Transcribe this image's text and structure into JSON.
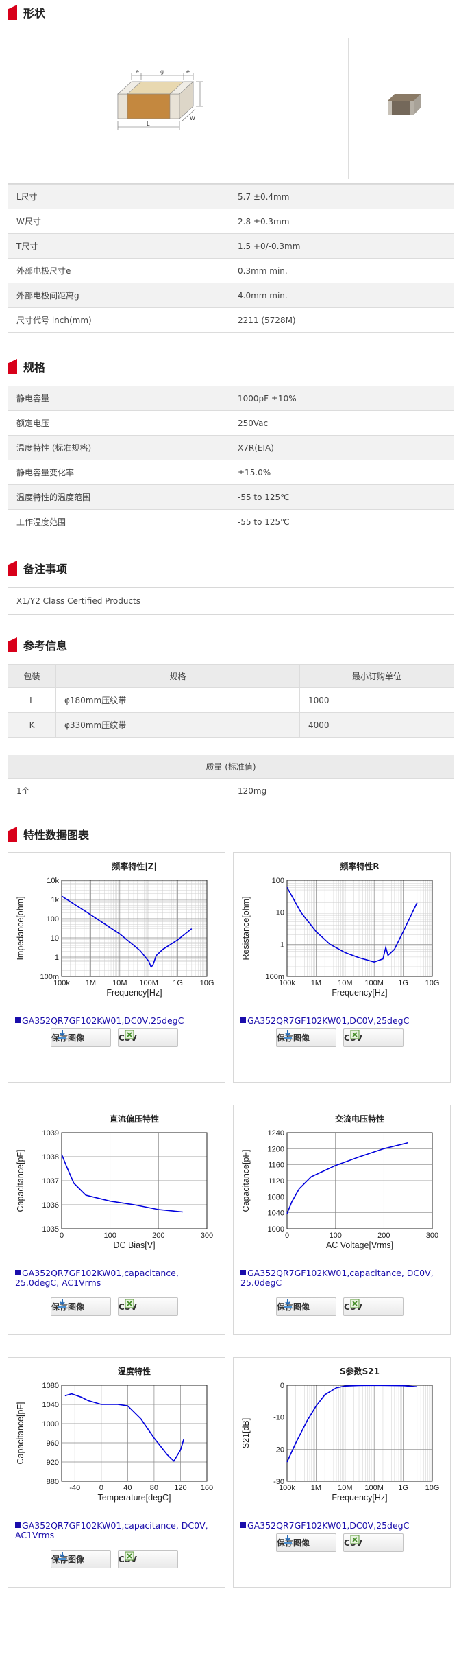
{
  "sections": {
    "shape": "形状",
    "spec": "规格",
    "notes": "备注事项",
    "reference": "参考信息",
    "charts": "特性数据图表"
  },
  "diagram": {
    "e": "e",
    "g": "g",
    "T": "T",
    "L": "L",
    "W": "W"
  },
  "shape_rows": [
    {
      "k": "L尺寸",
      "v": "5.7 ±0.4mm"
    },
    {
      "k": "W尺寸",
      "v": "2.8 ±0.3mm"
    },
    {
      "k": "T尺寸",
      "v": "1.5 +0/-0.3mm"
    },
    {
      "k": "外部电极尺寸e",
      "v": "0.3mm min."
    },
    {
      "k": "外部电极间距离g",
      "v": "4.0mm min."
    },
    {
      "k": "尺寸代号 inch(mm)",
      "v": "2211 (5728M)"
    }
  ],
  "spec_rows": [
    {
      "k": "静电容量",
      "v": "1000pF ±10%"
    },
    {
      "k": "额定电压",
      "v": "250Vac"
    },
    {
      "k": "温度特性 (标准规格)",
      "v": "X7R(EIA)"
    },
    {
      "k": "静电容量变化率",
      "v": "±15.0%"
    },
    {
      "k": "温度特性的温度范围",
      "v": "-55 to 125℃"
    },
    {
      "k": "工作温度范围",
      "v": "-55 to 125℃"
    }
  ],
  "notes_text": "X1/Y2 Class Certified Products",
  "packaging": {
    "headers": [
      "包装",
      "规格",
      "最小订购单位"
    ],
    "rows": [
      {
        "code": "L",
        "spec": "φ180mm压纹带",
        "min": "1000"
      },
      {
        "code": "K",
        "spec": "φ330mm压纹带",
        "min": "4000"
      }
    ]
  },
  "mass": {
    "header": "质量 (标准值)",
    "qty": "1个",
    "value": "120mg"
  },
  "buttons": {
    "save": "保存图像",
    "csv": "CSV"
  },
  "colors": {
    "accent": "#d8001a",
    "curve": "#0000dd",
    "link": "#1a0dab"
  },
  "chart_data": [
    {
      "type": "line",
      "title": "频率特性|Z|",
      "xlabel": "Frequency[Hz]",
      "ylabel": "Impedance[ohm]",
      "x_scale": "log",
      "y_scale": "log",
      "xlim": [
        100000,
        10000000000
      ],
      "ylim": [
        0.1,
        10000
      ],
      "x_ticks": [
        "100k",
        "1M",
        "10M",
        "100M",
        "1G",
        "10G"
      ],
      "y_ticks": [
        "100m",
        "1",
        "10",
        "100",
        "1k",
        "10k"
      ],
      "grid": true,
      "legend": "GA352QR7GF102KW01,DC0V,25degC",
      "series": [
        {
          "x": [
            100000,
            1000000,
            10000000,
            50000000,
            100000000,
            120000000,
            140000000,
            180000000,
            300000000,
            1000000000,
            3000000000
          ],
          "y": [
            1500,
            160,
            16,
            2.2,
            0.6,
            0.3,
            0.4,
            1.2,
            2.5,
            8,
            30
          ]
        }
      ]
    },
    {
      "type": "line",
      "title": "频率特性R",
      "xlabel": "Frequency[Hz]",
      "ylabel": "Resistance[ohm]",
      "x_scale": "log",
      "y_scale": "log",
      "xlim": [
        100000,
        10000000000
      ],
      "ylim": [
        0.1,
        100
      ],
      "x_ticks": [
        "100k",
        "1M",
        "10M",
        "100M",
        "1G",
        "10G"
      ],
      "y_ticks": [
        "100m",
        "1",
        "10",
        "100"
      ],
      "grid": true,
      "legend": "GA352QR7GF102KW01,DC0V,25degC",
      "series": [
        {
          "x": [
            100000,
            300000,
            1000000,
            3000000,
            10000000,
            30000000,
            100000000,
            200000000,
            250000000,
            300000000,
            500000000,
            1000000000,
            3000000000
          ],
          "y": [
            60,
            10,
            2.5,
            1.0,
            0.55,
            0.38,
            0.28,
            0.35,
            0.8,
            0.45,
            0.7,
            2.5,
            20
          ]
        }
      ]
    },
    {
      "type": "line",
      "title": "直流偏压特性",
      "xlabel": "DC Bias[V]",
      "ylabel": "Capacitance[pF]",
      "xlim": [
        0,
        300
      ],
      "ylim": [
        1035,
        1039
      ],
      "x_ticks": [
        "0",
        "100",
        "200",
        "300"
      ],
      "y_ticks": [
        "1035",
        "1036",
        "1037",
        "1038",
        "1039"
      ],
      "grid": true,
      "legend": "GA352QR7GF102KW01,capacitance, 25.0degC, AC1Vrms",
      "series": [
        {
          "x": [
            0,
            10,
            25,
            50,
            100,
            150,
            200,
            250
          ],
          "y": [
            1038.1,
            1037.6,
            1036.9,
            1036.4,
            1036.15,
            1036.0,
            1035.8,
            1035.7
          ]
        }
      ]
    },
    {
      "type": "line",
      "title": "交流电压特性",
      "xlabel": "AC Voltage[Vrms]",
      "ylabel": "Capacitance[pF]",
      "xlim": [
        0,
        300
      ],
      "ylim": [
        1000,
        1240
      ],
      "x_ticks": [
        "0",
        "100",
        "200",
        "300"
      ],
      "y_ticks": [
        "1000",
        "1040",
        "1080",
        "1120",
        "1160",
        "1200",
        "1240"
      ],
      "grid": true,
      "legend": "GA352QR7GF102KW01,capacitance, DC0V, 25.0degC",
      "series": [
        {
          "x": [
            0,
            10,
            25,
            50,
            100,
            150,
            200,
            250
          ],
          "y": [
            1038,
            1068,
            1100,
            1130,
            1158,
            1180,
            1200,
            1215
          ]
        }
      ]
    },
    {
      "type": "line",
      "title": "温度特性",
      "xlabel": "Temperature[degC]",
      "ylabel": "Capacitance[pF]",
      "xlim": [
        -60,
        160
      ],
      "ylim": [
        880,
        1080
      ],
      "x_ticks": [
        "-40",
        "0",
        "40",
        "80",
        "120",
        "160"
      ],
      "y_ticks": [
        "880",
        "920",
        "960",
        "1000",
        "1040",
        "1080"
      ],
      "grid": true,
      "legend": "GA352QR7GF102KW01,capacitance, DC0V, AC1Vrms",
      "series": [
        {
          "x": [
            -55,
            -45,
            -30,
            -20,
            0,
            25,
            40,
            60,
            80,
            100,
            110,
            120,
            125
          ],
          "y": [
            1058,
            1062,
            1055,
            1048,
            1040,
            1040,
            1037,
            1010,
            970,
            935,
            922,
            945,
            968
          ]
        }
      ]
    },
    {
      "type": "line",
      "title": "S参数S21",
      "xlabel": "Frequency[Hz]",
      "ylabel": "S21[dB]",
      "x_scale": "log",
      "xlim": [
        100000,
        10000000000
      ],
      "ylim": [
        -30,
        0
      ],
      "x_ticks": [
        "100k",
        "1M",
        "10M",
        "100M",
        "1G",
        "10G"
      ],
      "y_ticks": [
        "-30",
        "-20",
        "-10",
        "0"
      ],
      "grid": true,
      "legend": "GA352QR7GF102KW01,DC0V,25degC",
      "series": [
        {
          "x": [
            100000,
            200000,
            500000,
            1000000,
            2000000,
            5000000,
            10000000,
            30000000,
            100000000,
            1000000000,
            3000000000
          ],
          "y": [
            -24,
            -18,
            -11,
            -6.5,
            -3,
            -0.8,
            -0.25,
            -0.1,
            -0.05,
            -0.15,
            -0.5
          ]
        }
      ]
    }
  ]
}
